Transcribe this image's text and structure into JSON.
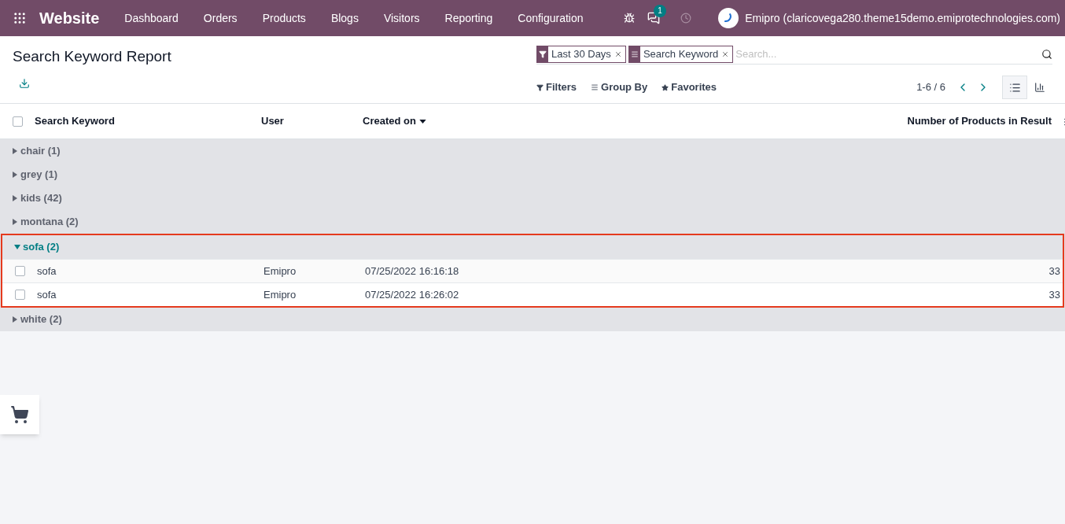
{
  "navbar": {
    "app": "Website",
    "menu": [
      "Dashboard",
      "Orders",
      "Products",
      "Blogs",
      "Visitors",
      "Reporting",
      "Configuration"
    ],
    "messages_badge": "1",
    "user": "Emipro (claricovega280.theme15demo.emiprotechnologies.com)"
  },
  "control_panel": {
    "title": "Search Keyword Report",
    "facets": [
      {
        "kind": "filter",
        "label": "Last 30 Days"
      },
      {
        "kind": "groupby",
        "label": "Search Keyword"
      }
    ],
    "search": {
      "placeholder": "Search..."
    },
    "menus": [
      {
        "kind": "filter",
        "label": "Filters"
      },
      {
        "kind": "groupby",
        "label": "Group By"
      },
      {
        "kind": "favorite",
        "label": "Favorites"
      }
    ],
    "pager": "1-6 / 6",
    "views": [
      {
        "kind": "list",
        "selected": true
      },
      {
        "kind": "graph",
        "selected": false
      }
    ]
  },
  "table": {
    "all_checked": false,
    "columns": [
      "Search Keyword",
      "User",
      "Created on",
      "Number of Products in Result"
    ],
    "groups": [
      {
        "label": "chair (1)",
        "expanded": false,
        "highlighted": false
      },
      {
        "label": "grey (1)",
        "expanded": false,
        "highlighted": false
      },
      {
        "label": "kids (42)",
        "expanded": false,
        "highlighted": false
      },
      {
        "label": "montana (2)",
        "expanded": false,
        "highlighted": false
      },
      {
        "label": "sofa (2)",
        "expanded": true,
        "highlighted": true,
        "rows": [
          {
            "keyword": "sofa",
            "user": "Emipro",
            "created_on": "07/25/2022 16:16:18",
            "products": "33",
            "checked": false
          },
          {
            "keyword": "sofa",
            "user": "Emipro",
            "created_on": "07/25/2022 16:26:02",
            "products": "33",
            "checked": false
          }
        ]
      },
      {
        "label": "white (2)",
        "expanded": false,
        "highlighted": false
      }
    ]
  }
}
